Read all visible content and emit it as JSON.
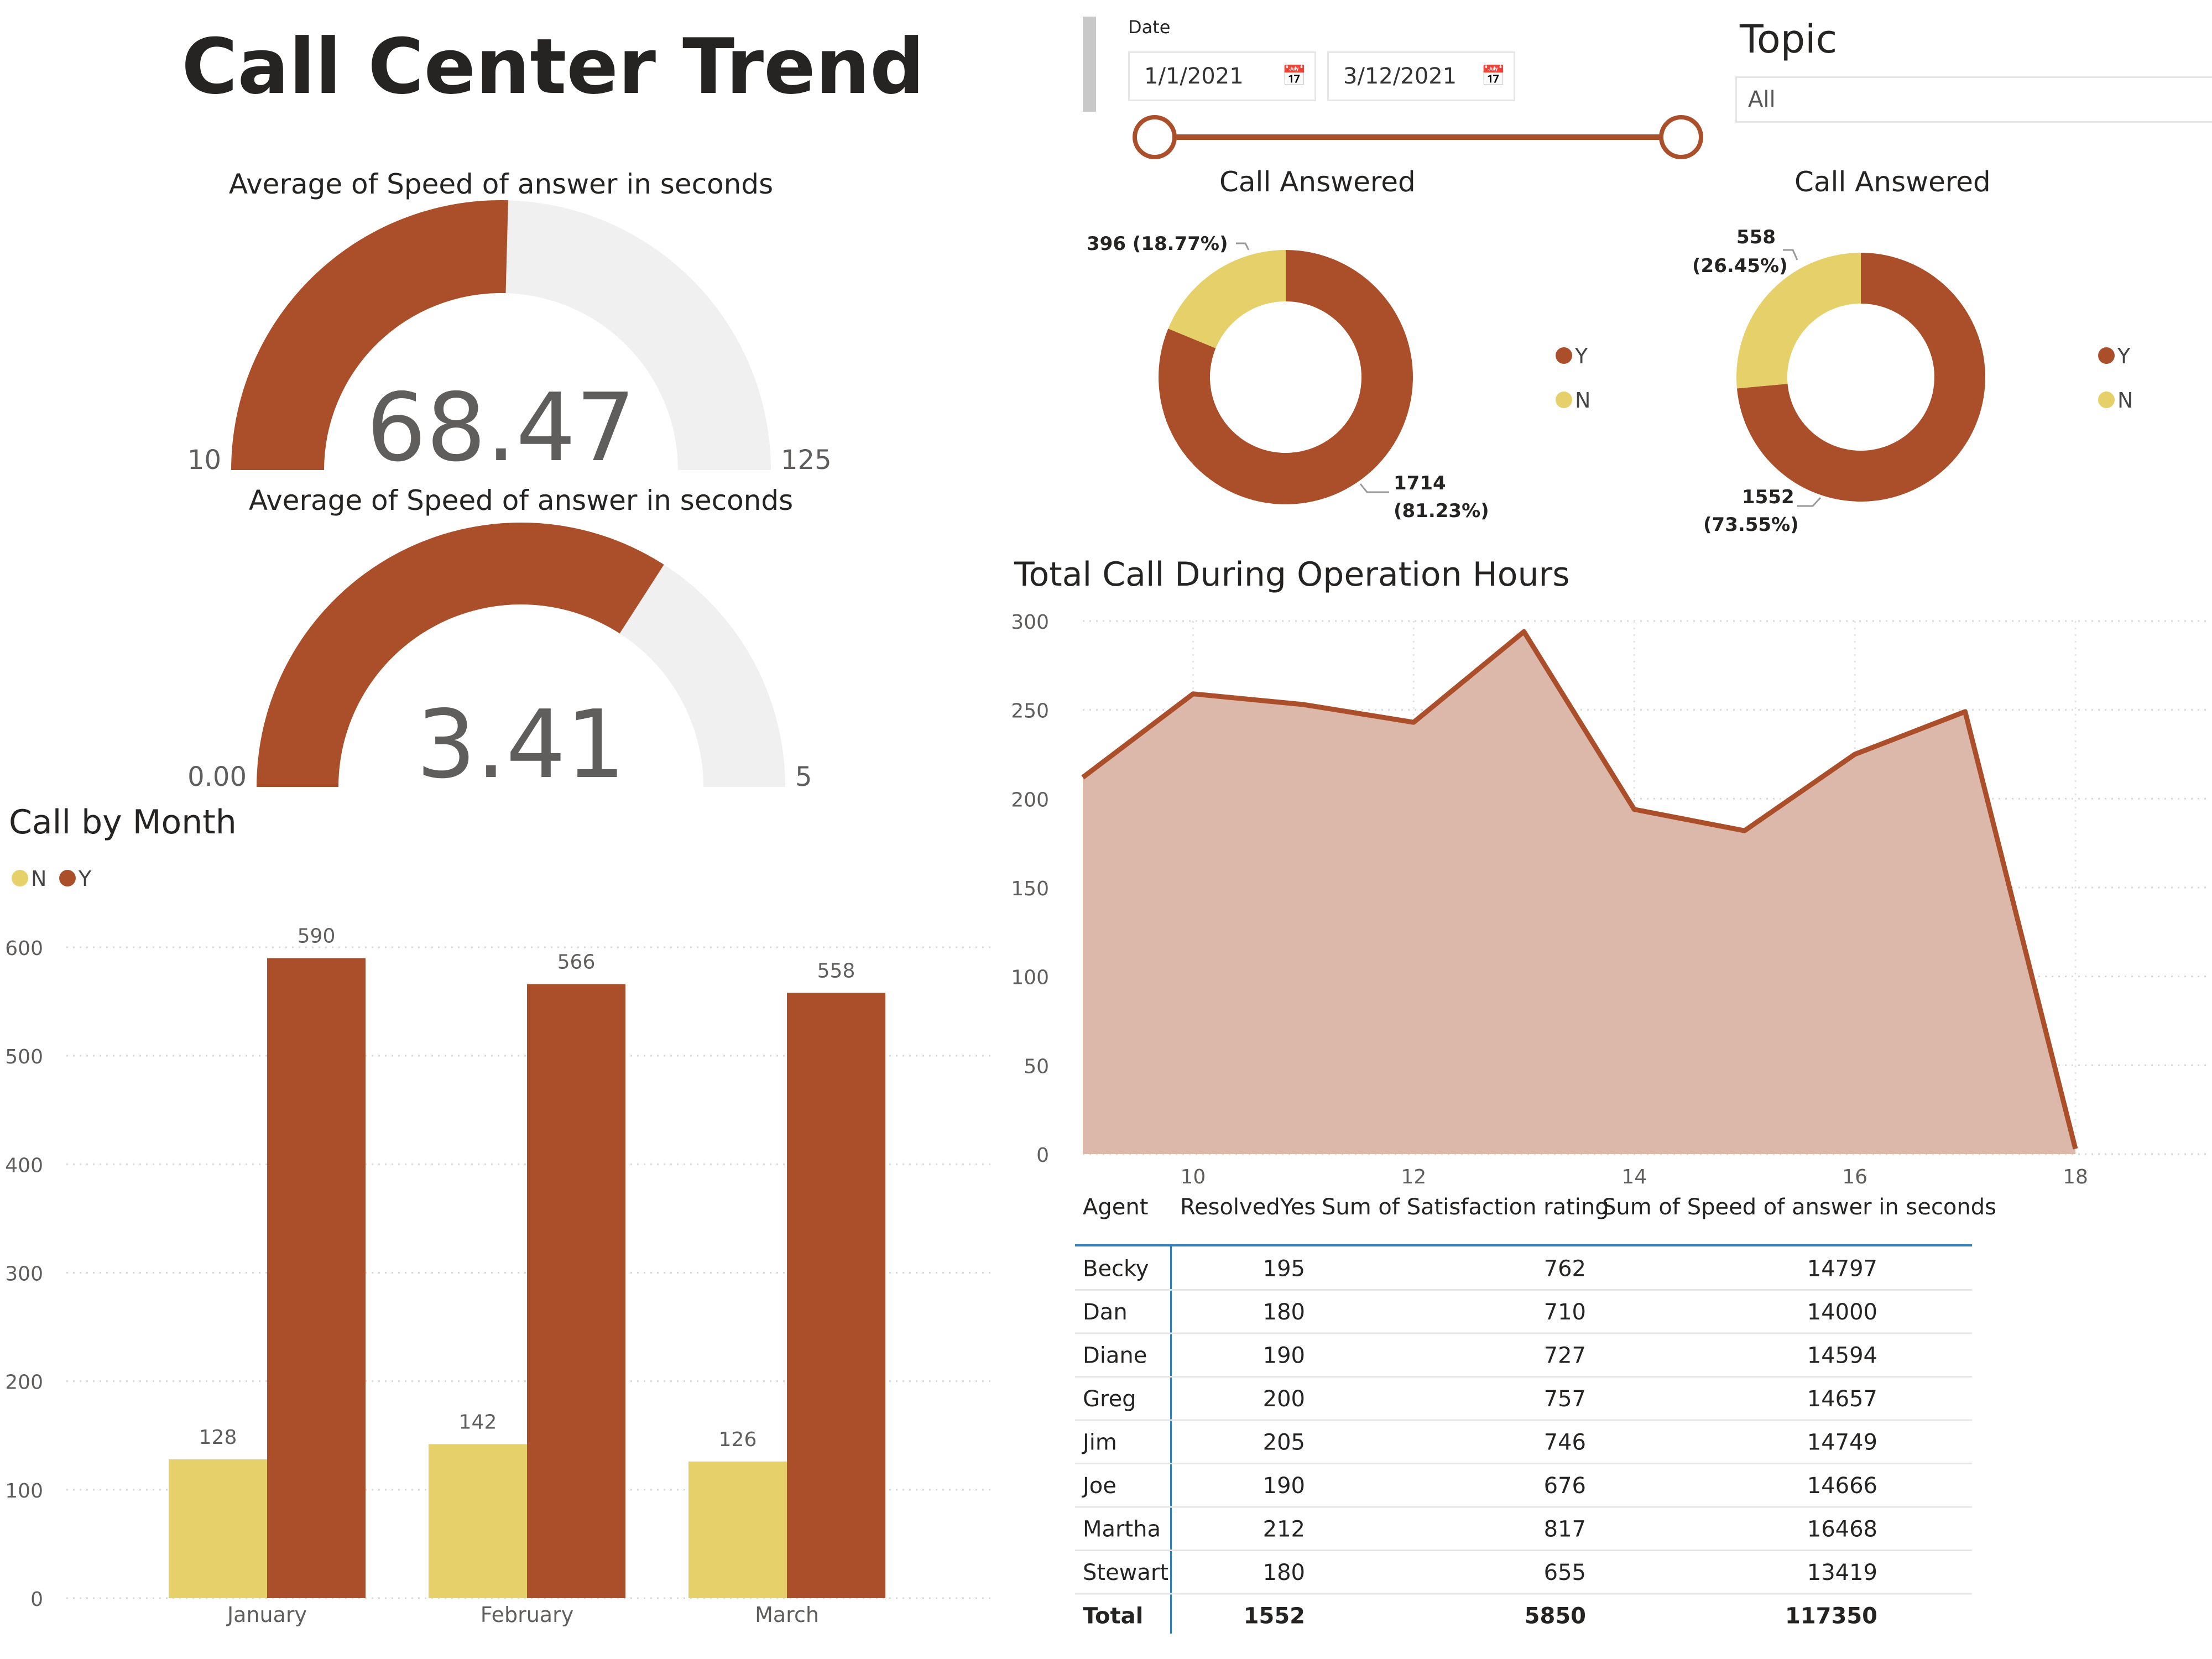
{
  "title": "Call Center Trend",
  "gauges": [
    {
      "title": "Average of Speed of answer in seconds",
      "value": 68.47,
      "value_label": "68.47",
      "min": 10,
      "max": 125,
      "min_label": "10",
      "max_label": "125",
      "fill": "#ab4f2a",
      "track": "#f0f0f0"
    },
    {
      "title": "Average of Speed of answer in seconds",
      "value": 3.41,
      "value_label": "3.41",
      "min": 0,
      "max": 5,
      "min_label": "0.00",
      "max_label": "5",
      "fill": "#ab4f2a",
      "track": "#f0f0f0"
    }
  ],
  "slicer": {
    "date_label": "Date",
    "start": "1/1/2021",
    "end": "3/12/2021",
    "topic_title": "Topic",
    "topic_value": "All",
    "calendar_icon": "calendar-icon"
  },
  "colors": {
    "Y": "#ab4f2a",
    "N": "#e6d06a",
    "area_fill": "#dbb8aa"
  },
  "chart_data": [
    {
      "type": "pie",
      "title": "Call Answered",
      "donut": true,
      "legend": [
        "Y",
        "N"
      ],
      "legend_position": "right",
      "slices": [
        {
          "name": "Y",
          "value": 1714,
          "pct": "81.23%"
        },
        {
          "name": "N",
          "value": 396,
          "pct": "18.77%"
        }
      ],
      "labels": [
        "1714",
        "(81.23%)",
        "396 (18.77%)"
      ]
    },
    {
      "type": "pie",
      "title": "Call Answered",
      "donut": true,
      "legend": [
        "Y",
        "N"
      ],
      "legend_position": "right",
      "slices": [
        {
          "name": "Y",
          "value": 1552,
          "pct": "73.55%"
        },
        {
          "name": "N",
          "value": 558,
          "pct": "26.45%"
        }
      ],
      "labels": [
        "1552",
        "(73.55%)",
        "558",
        "(26.45%)"
      ]
    },
    {
      "type": "bar",
      "title": "Call by Month",
      "legend": [
        "N",
        "Y"
      ],
      "legend_position": "top-left",
      "categories": [
        "January",
        "February",
        "March"
      ],
      "series": [
        {
          "name": "N",
          "values": [
            128,
            142,
            126
          ]
        },
        {
          "name": "Y",
          "values": [
            590,
            566,
            558
          ]
        }
      ],
      "ylim": [
        0,
        600
      ],
      "yticks": [
        0,
        100,
        200,
        300,
        400,
        500,
        600
      ],
      "grid": true
    },
    {
      "type": "area",
      "title": "Total Call During Operation Hours",
      "x": [
        9,
        10,
        11,
        12,
        13,
        14,
        15,
        16,
        17,
        18
      ],
      "y": [
        212,
        259,
        253,
        243,
        294,
        194,
        182,
        225,
        249,
        3
      ],
      "xlim": [
        9,
        18
      ],
      "xticks": [
        10,
        12,
        14,
        16,
        18
      ],
      "ylim": [
        0,
        300
      ],
      "yticks": [
        0,
        50,
        100,
        150,
        200,
        250,
        300
      ],
      "grid": true
    },
    {
      "type": "table",
      "columns": [
        "Agent",
        "ResolvedYes",
        "Sum of Satisfaction rating",
        "Sum of Speed of answer in seconds"
      ],
      "rows": [
        [
          "Becky",
          "195",
          "762",
          "14797"
        ],
        [
          "Dan",
          "180",
          "710",
          "14000"
        ],
        [
          "Diane",
          "190",
          "727",
          "14594"
        ],
        [
          "Greg",
          "200",
          "757",
          "14657"
        ],
        [
          "Jim",
          "205",
          "746",
          "14749"
        ],
        [
          "Joe",
          "190",
          "676",
          "14666"
        ],
        [
          "Martha",
          "212",
          "817",
          "16468"
        ],
        [
          "Stewart",
          "180",
          "655",
          "13419"
        ]
      ],
      "total": [
        "Total",
        "1552",
        "5850",
        "117350"
      ]
    }
  ]
}
